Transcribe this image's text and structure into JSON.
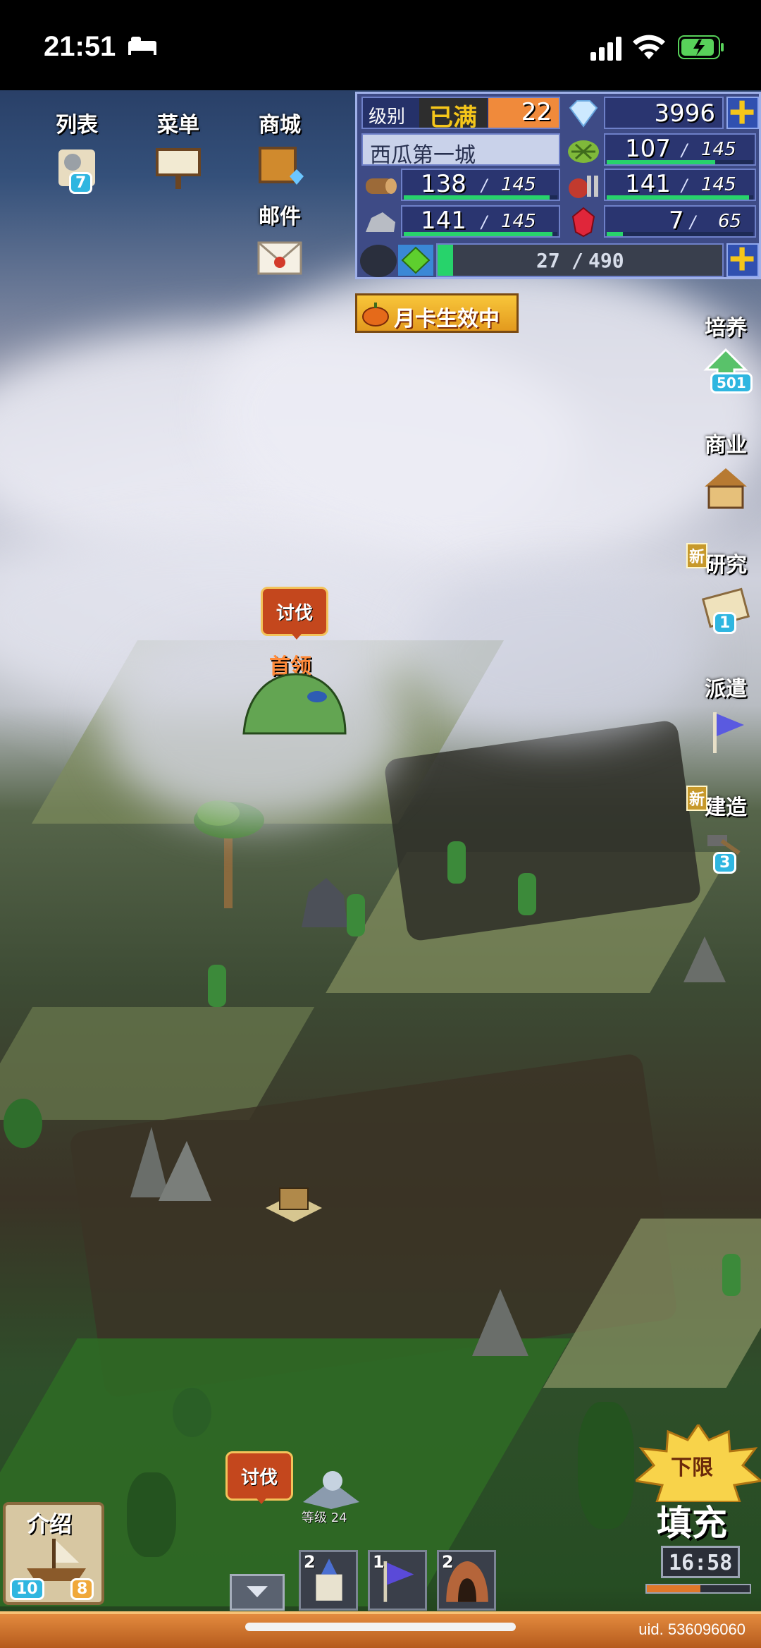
{
  "status_bar": {
    "time": "21:51"
  },
  "top_menu": {
    "list": {
      "label": "列表",
      "badge": "7"
    },
    "menu": {
      "label": "菜单"
    },
    "shop": {
      "label": "商城"
    },
    "mail": {
      "label": "邮件"
    }
  },
  "resources": {
    "level_label": "级别",
    "level_status": "已满",
    "level_value": "22",
    "gems": "3996",
    "city_name": "西瓜第一城",
    "grass": {
      "value": "107",
      "max": "145",
      "fill": 0.74
    },
    "wood": {
      "value": "138",
      "max": "145",
      "fill": 0.95
    },
    "food": {
      "value": "141",
      "max": "145",
      "fill": 0.97
    },
    "stone": {
      "value": "141",
      "max": "145",
      "fill": 0.97
    },
    "ruby": {
      "value": "7",
      "max": "65",
      "fill": 0.11
    },
    "exp": {
      "value": "27",
      "max": "490",
      "fill": 0.055
    },
    "plus": "+"
  },
  "monthly_card": "月卡生效中",
  "side_buttons": {
    "train": {
      "label": "培养",
      "badge": "501"
    },
    "business": {
      "label": "商业"
    },
    "research": {
      "label": "研究",
      "new": "新",
      "badge": "1"
    },
    "dispatch": {
      "label": "派遣"
    },
    "build": {
      "label": "建造",
      "new": "新",
      "badge": "3"
    }
  },
  "map": {
    "boss_attack": "讨伐",
    "boss_label": "首领",
    "lower_attack": "讨伐",
    "lower_level": "等级 24"
  },
  "intro": {
    "label": "介绍",
    "badge_left": "10",
    "badge_right": "8"
  },
  "bottom_units": {
    "a": "2",
    "b": "1",
    "c": "2"
  },
  "recharge": {
    "label_top": "下限",
    "label": "填充",
    "timer": "16:58"
  },
  "uid": "uid. 536096060"
}
